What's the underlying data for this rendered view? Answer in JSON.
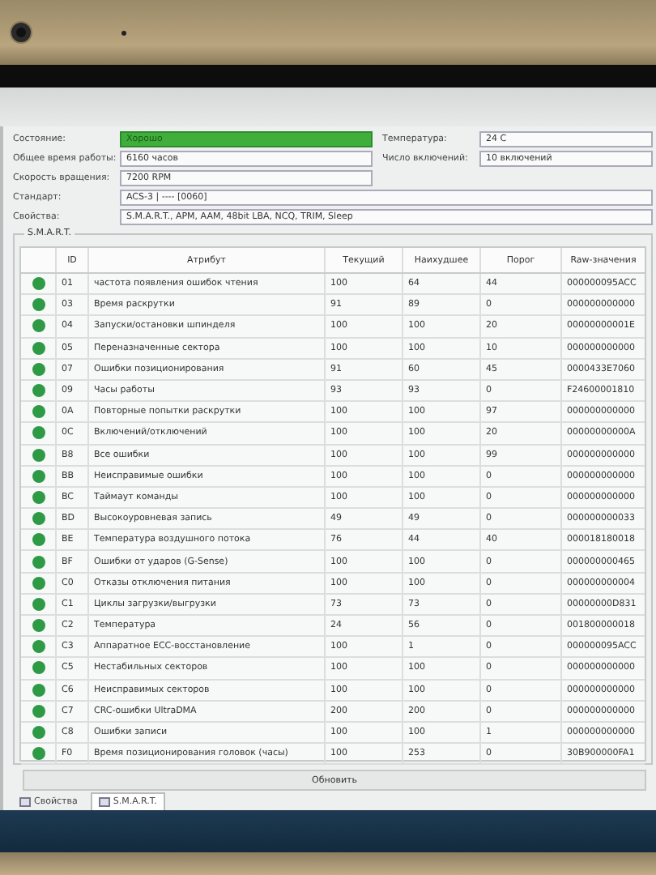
{
  "info": {
    "status": {
      "label": "Состояние:",
      "value": "Хорошо",
      "color": "#3fae3a"
    },
    "temperature": {
      "label": "Температура:",
      "value": "24 C"
    },
    "hours": {
      "label": "Общее время работы:",
      "value": "6160 часов"
    },
    "power_count": {
      "label": "Число включений:",
      "value": "10 включений"
    },
    "rotation": {
      "label": "Скорость вращения:",
      "value": "7200 RPM"
    },
    "standard": {
      "label": "Стандарт:",
      "value": "ACS-3 | ---- [0060]"
    },
    "features": {
      "label": "Свойства:",
      "value": "S.M.A.R.T., APM, AAM, 48bit LBA, NCQ, TRIM, Sleep"
    }
  },
  "smart": {
    "title": "S.M.A.R.T.",
    "columns": [
      "ID",
      "Атрибут",
      "Текущий",
      "Наихудшее",
      "Порог",
      "Raw-значения"
    ],
    "rows": [
      {
        "color": "#2e9a45",
        "cells": [
          "01",
          "частота появления ошибок чтения",
          "100",
          "64",
          "44",
          "000000095ACC"
        ]
      },
      {
        "color": "#2e9a45",
        "cells": [
          "03",
          "Время раскрутки",
          "91",
          "89",
          "0",
          "000000000000"
        ]
      },
      {
        "color": "#2e9a45",
        "cells": [
          "04",
          "Запуски/остановки шпинделя",
          "100",
          "100",
          "20",
          "00000000001E"
        ]
      },
      {
        "color": "#2e9a45",
        "cells": [
          "05",
          "Переназначенные сектора",
          "100",
          "100",
          "10",
          "000000000000"
        ]
      },
      {
        "color": "#2e9a45",
        "cells": [
          "07",
          "Ошибки позиционирования",
          "91",
          "60",
          "45",
          "0000433E7060"
        ]
      },
      {
        "color": "#2e9a45",
        "cells": [
          "09",
          "Часы работы",
          "93",
          "93",
          "0",
          "F24600001810"
        ]
      },
      {
        "color": "#2e9a45",
        "cells": [
          "0A",
          "Повторные попытки раскрутки",
          "100",
          "100",
          "97",
          "000000000000"
        ]
      },
      {
        "color": "#2e9a45",
        "cells": [
          "0C",
          "Включений/отключений",
          "100",
          "100",
          "20",
          "00000000000A"
        ]
      },
      {
        "color": "#2e9a45",
        "cells": [
          "B8",
          "Все ошибки",
          "100",
          "100",
          "99",
          "000000000000"
        ]
      },
      {
        "color": "#2e9a45",
        "cells": [
          "BB",
          "Неисправимые ошибки",
          "100",
          "100",
          "0",
          "000000000000"
        ]
      },
      {
        "color": "#2e9a45",
        "cells": [
          "BC",
          "Таймаут команды",
          "100",
          "100",
          "0",
          "000000000000"
        ]
      },
      {
        "color": "#2e9a45",
        "cells": [
          "BD",
          "Высокоуровневая запись",
          "49",
          "49",
          "0",
          "000000000033"
        ]
      },
      {
        "color": "#2e9a45",
        "cells": [
          "BE",
          "Температура воздушного потока",
          "76",
          "44",
          "40",
          "000018180018"
        ]
      },
      {
        "color": "#2e9a45",
        "cells": [
          "BF",
          "Ошибки от ударов (G-Sense)",
          "100",
          "100",
          "0",
          "000000000465"
        ]
      },
      {
        "color": "#2e9a45",
        "cells": [
          "C0",
          "Отказы отключения питания",
          "100",
          "100",
          "0",
          "000000000004"
        ]
      },
      {
        "color": "#2e9a45",
        "cells": [
          "C1",
          "Циклы загрузки/выгрузки",
          "73",
          "73",
          "0",
          "00000000D831"
        ]
      },
      {
        "color": "#2e9a45",
        "cells": [
          "C2",
          "Температура",
          "24",
          "56",
          "0",
          "001800000018"
        ]
      },
      {
        "color": "#2e9a45",
        "cells": [
          "C3",
          "Аппаратное ECC-восстановление",
          "100",
          "1",
          "0",
          "000000095ACC"
        ]
      },
      {
        "color": "#2e9a45",
        "cells": [
          "C5",
          "Нестабильных секторов",
          "100",
          "100",
          "0",
          "000000000000"
        ]
      },
      {
        "color": "#2e9a45",
        "cells": [
          "C6",
          "Неисправимых секторов",
          "100",
          "100",
          "0",
          "000000000000"
        ]
      },
      {
        "color": "#2e9a45",
        "cells": [
          "C7",
          "CRC-ошибки UltraDMA",
          "200",
          "200",
          "0",
          "000000000000"
        ]
      },
      {
        "color": "#2e9a45",
        "cells": [
          "C8",
          "Ошибки записи",
          "100",
          "100",
          "1",
          "000000000000"
        ]
      },
      {
        "color": "#2e9a45",
        "cells": [
          "F0",
          "Время позиционирования головок (часы)",
          "100",
          "253",
          "0",
          "30B900000FA1"
        ]
      }
    ]
  },
  "refresh_button": "Обновить",
  "tabs": [
    {
      "label": "Свойства",
      "selected": false
    },
    {
      "label": "S.M.A.R.T.",
      "selected": true
    }
  ]
}
